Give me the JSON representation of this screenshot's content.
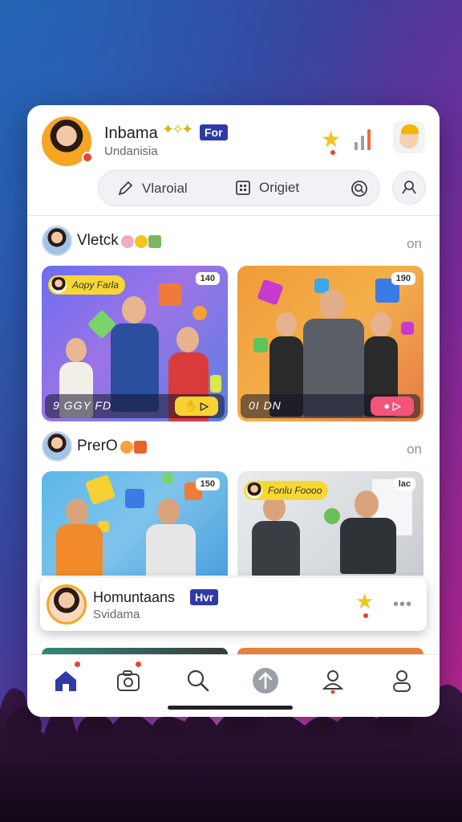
{
  "header": {
    "name": "Inbama",
    "subtitle": "Undanisia",
    "badge": "For",
    "tabs": [
      {
        "label": "Vlaroial",
        "icon": "pencil-icon"
      },
      {
        "label": "Origiet",
        "icon": "grid-icon"
      }
    ]
  },
  "sections": [
    {
      "title": "Vletck",
      "meta": "on",
      "cards": [
        {
          "pill": "Aopy Farla",
          "count": "140",
          "bottom": "9 GGY FD",
          "color": "#f6d233"
        },
        {
          "pill": "",
          "count": "190",
          "bottom": "0I DN",
          "color": "#f4537a"
        }
      ]
    },
    {
      "title": "PrerO",
      "meta": "on",
      "cards": [
        {
          "pill": "",
          "count": "150"
        },
        {
          "pill": "Fonlu Foooo",
          "count": "lac"
        }
      ]
    }
  ],
  "float_card": {
    "name": "Homuntaans",
    "subtitle": "Svidama",
    "badge": "Hvr"
  },
  "nav": {
    "items": [
      "home-icon",
      "camera-icon",
      "search-icon",
      "upload-icon",
      "profile-alert-icon",
      "profile-icon"
    ]
  },
  "colors": {
    "accent_blue": "#2f3aa8",
    "star": "#f6c21c",
    "alert": "#e8452c"
  }
}
